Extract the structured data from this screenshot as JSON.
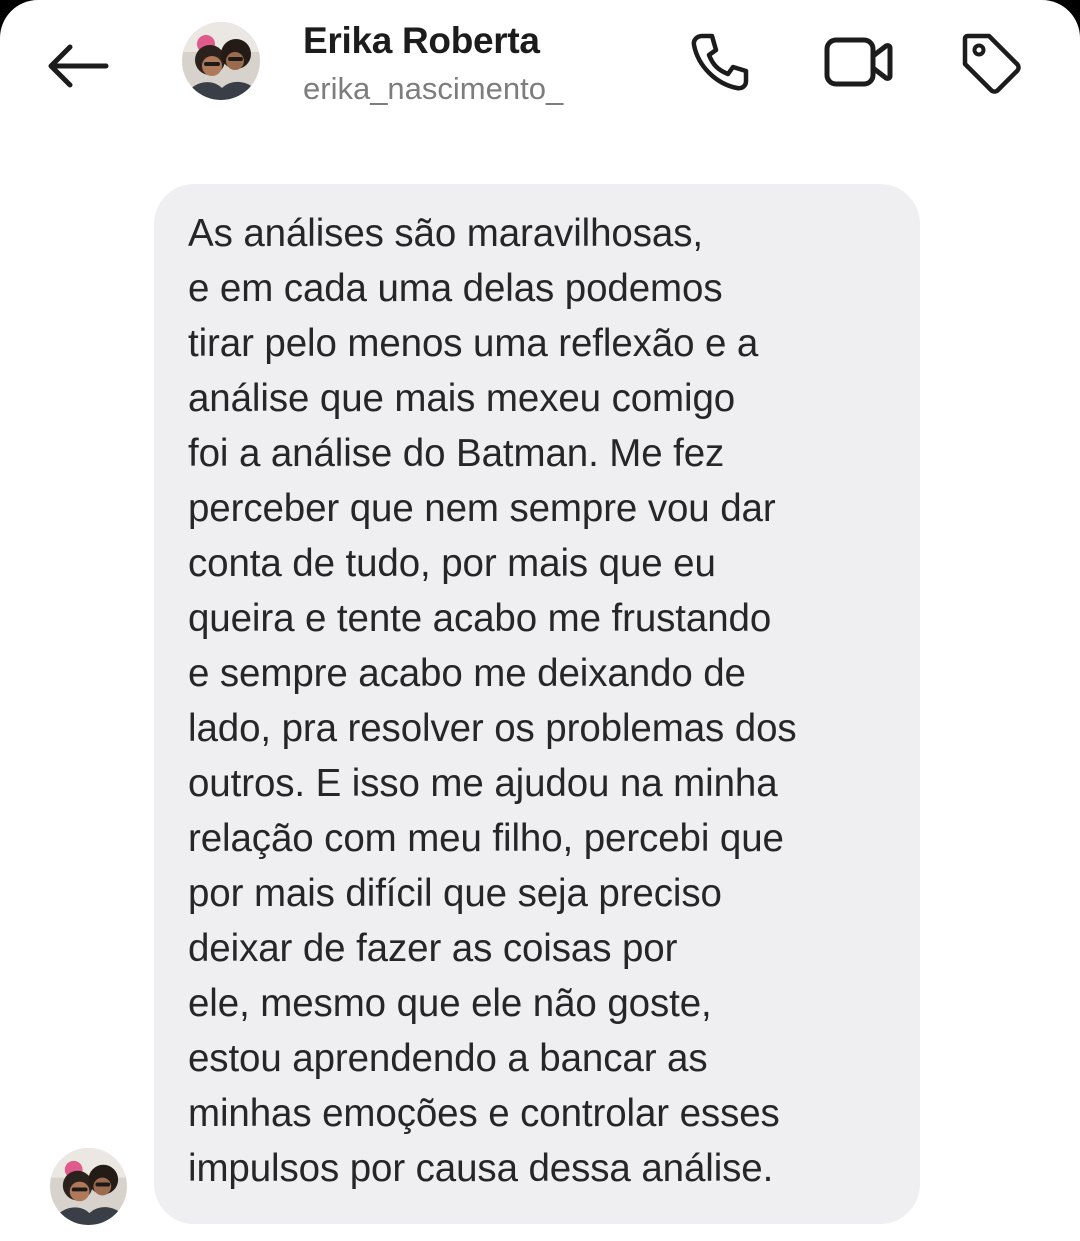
{
  "header": {
    "back_icon": "arrow-left-icon",
    "contact_name": "Erika Roberta",
    "contact_username": "erika_nascimento_",
    "avatar": "profile-photo",
    "actions": [
      {
        "name": "call",
        "icon": "phone-icon"
      },
      {
        "name": "video-call",
        "icon": "video-camera-icon"
      },
      {
        "name": "tag",
        "icon": "tag-icon"
      }
    ]
  },
  "message": {
    "lines": [
      "As análises são maravilhosas,",
      "e em cada uma delas podemos",
      "tirar pelo menos uma reflexão e a",
      "análise que mais mexeu comigo",
      "foi a análise do Batman. Me fez",
      "perceber que nem sempre vou dar",
      "conta de tudo, por mais que eu",
      "queira e tente acabo me frustando",
      "e sempre acabo me deixando de",
      "lado, pra resolver os problemas dos",
      "outros. E isso me ajudou na minha",
      "relação com meu filho, percebi que",
      "por mais difícil que seja preciso",
      "deixar de fazer as coisas por",
      "ele, mesmo que ele não goste,",
      "estou aprendendo a bancar as",
      "minhas emoções e controlar esses",
      "impulsos por causa dessa análise."
    ],
    "bubble_color": "#efeff2",
    "text_color": "#262626"
  },
  "colors": {
    "background": "#ffffff",
    "icon": "#1c1c1c",
    "username": "#7d7d7d"
  }
}
